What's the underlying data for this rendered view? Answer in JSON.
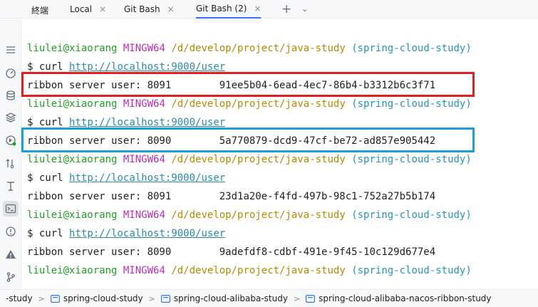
{
  "tabs": {
    "panel_title": "終端",
    "items": [
      {
        "label": "Local"
      },
      {
        "label": "Git Bash"
      },
      {
        "label": "Git Bash (2)"
      }
    ],
    "close_glyph": "×",
    "add_glyph": "+",
    "more_glyph": "⌄"
  },
  "colors": {
    "user": "#20a023",
    "system": "#b82fb8",
    "path": "#b08d00",
    "branch": "#2496b8",
    "url": "#2d8ba6",
    "highlight_red": "#e02020",
    "highlight_blue": "#1a9ed6"
  },
  "terminal": {
    "prompt": {
      "user": "liulei@xiaorang",
      "system": "MINGW64",
      "path": "/d/develop/project/java-study",
      "branch": "(spring-cloud-study)"
    },
    "dollar": "$",
    "cmd": "curl",
    "url": "http://localhost:9000/user",
    "responses": [
      {
        "text": "ribbon server user: 8091",
        "id": "91ee5b04-6ead-4ec7-86b4-b3312b6c3f71"
      },
      {
        "text": "ribbon server user: 8090",
        "id": "5a770879-dcd9-47cf-be72-ad857e905442"
      },
      {
        "text": "ribbon server user: 8091",
        "id": "23d1a20e-f4fd-497b-98c1-752a27b5b174"
      },
      {
        "text": "ribbon server user: 8090",
        "id": "9adefdf8-cdbf-491e-9f45-10c129d677e4"
      }
    ]
  },
  "breadcrumb": {
    "items": [
      {
        "label": "-study"
      },
      {
        "label": "spring-cloud-study"
      },
      {
        "label": "spring-cloud-alibaba-study"
      },
      {
        "label": "spring-cloud-alibaba-nacos-ribbon-study"
      }
    ],
    "sep": ">"
  },
  "toolbar_icons": [
    "list-icon",
    "dashboard-icon",
    "database-icon",
    "layers-icon",
    "plugin-icon",
    "git-push-icon",
    "text-format-icon",
    "terminal-icon",
    "warning-circle-icon",
    "alert-triangle-icon",
    "git-branch-icon"
  ]
}
